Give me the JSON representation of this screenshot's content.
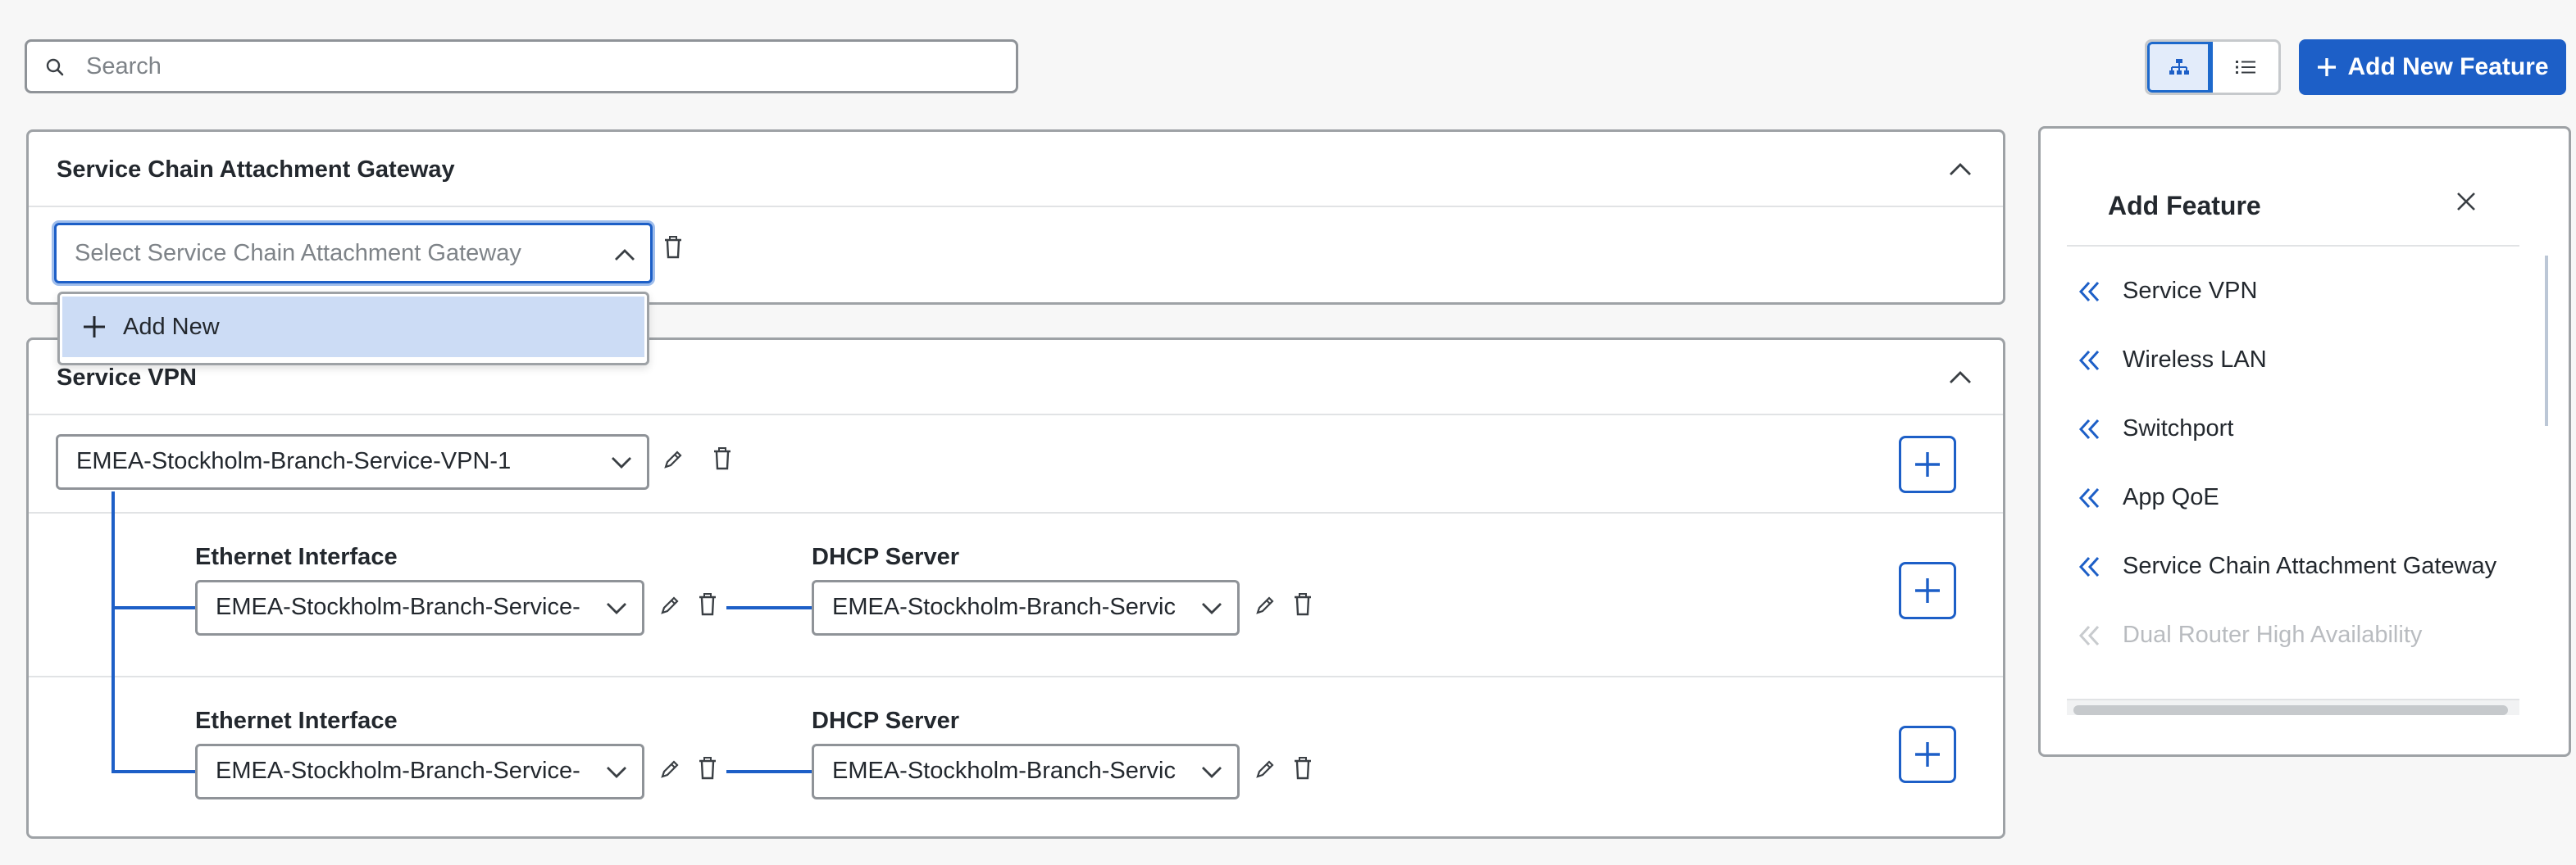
{
  "search": {
    "placeholder": "Search"
  },
  "toolbar": {
    "add_feature_label": "Add New Feature"
  },
  "gateway_card": {
    "title": "Service Chain Attachment Gateway",
    "select_placeholder": "Select Service Chain Attachment Gateway",
    "dropdown_option": "Add New"
  },
  "vpn_card": {
    "title": "Service VPN",
    "vpn_select": "EMEA-Stockholm-Branch-Service-VPN-1",
    "rows": [
      {
        "interface_label": "Ethernet Interface",
        "interface_value": "EMEA-Stockholm-Branch-Service-",
        "dhcp_label": "DHCP Server",
        "dhcp_value": "EMEA-Stockholm-Branch-Servic"
      },
      {
        "interface_label": "Ethernet Interface",
        "interface_value": "EMEA-Stockholm-Branch-Service-",
        "dhcp_label": "DHCP Server",
        "dhcp_value": "EMEA-Stockholm-Branch-Servic"
      }
    ]
  },
  "add_feature_panel": {
    "title": "Add Feature",
    "items": [
      {
        "label": "Service VPN",
        "disabled": false
      },
      {
        "label": "Wireless LAN",
        "disabled": false
      },
      {
        "label": "Switchport",
        "disabled": false
      },
      {
        "label": "App QoE",
        "disabled": false
      },
      {
        "label": "Service Chain Attachment Gateway",
        "disabled": false
      },
      {
        "label": "Dual Router High Availability",
        "disabled": true
      }
    ]
  },
  "colors": {
    "accent": "#1d5fc7",
    "selected_option_bg": "#ccdcf5",
    "disabled_text": "#b9bcc0",
    "border": "#9ea2a6"
  }
}
